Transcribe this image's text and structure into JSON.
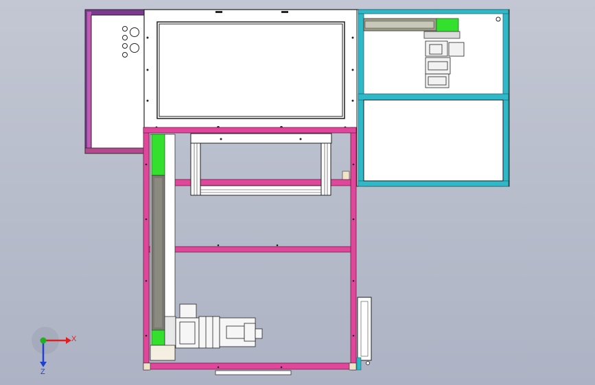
{
  "colors": {
    "background_top": "#c3c7d3",
    "background_bottom": "#adb3c4",
    "frame_pink": "#e0479b",
    "frame_purple": "#6a2d7d",
    "frame_cyan": "#2fb8c7",
    "highlight_green": "#33e02e",
    "rail_gray": "#7a7a72",
    "panel_white": "#ffffff",
    "outline": "#1e1e1e",
    "axis_x": "#e02020",
    "axis_y": "#20b020",
    "axis_z": "#2040d0"
  },
  "triad": {
    "x_label": "X",
    "z_label": "Z"
  },
  "icons": [
    "coordinate-triad-icon"
  ]
}
